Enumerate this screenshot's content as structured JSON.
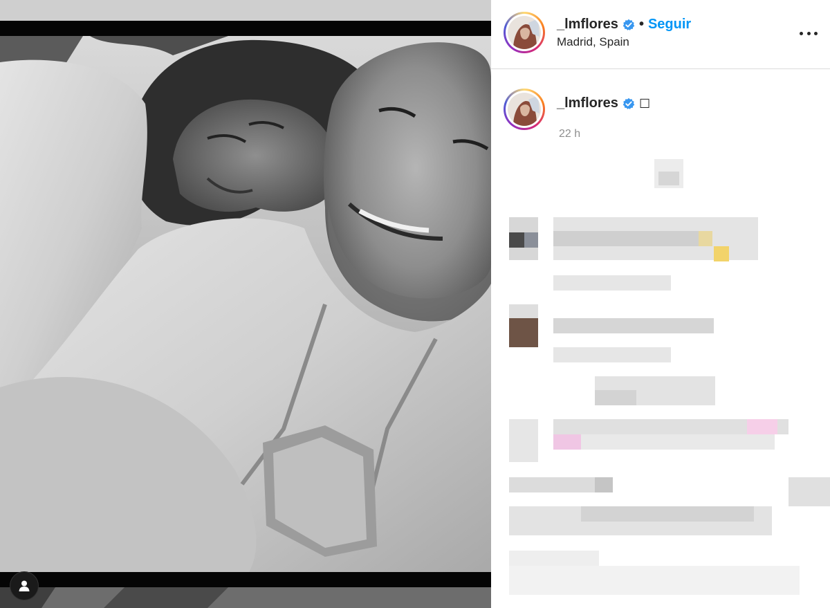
{
  "post": {
    "username": "_lmflores",
    "separator": "•",
    "follow_label": "Seguir",
    "location": "Madrid, Spain",
    "caption_box_glyph": "☐",
    "time_ago": "22 h"
  },
  "icons": {
    "verified": "verified-badge-icon",
    "more": "more-options-icon",
    "tag": "user-tag-icon"
  },
  "colors": {
    "accent": "#0095f6",
    "verified": "#3897f0",
    "text": "#262626",
    "muted": "#8e8e8e",
    "divider": "#dbdbdb"
  }
}
